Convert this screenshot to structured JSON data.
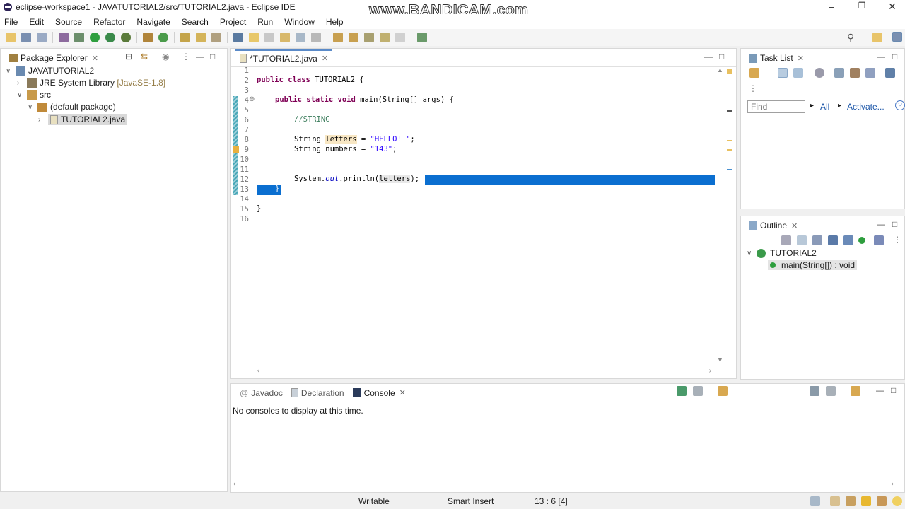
{
  "window": {
    "title": "eclipse-workspace1 - JAVATUTORIAL2/src/TUTORIAL2.java - Eclipse IDE",
    "watermark": "www.BANDICAM.com"
  },
  "menu": [
    "File",
    "Edit",
    "Source",
    "Refactor",
    "Navigate",
    "Search",
    "Project",
    "Run",
    "Window",
    "Help"
  ],
  "package_explorer": {
    "tab": "Package Explorer",
    "project": "JAVATUTORIAL2",
    "jre": "JRE System Library",
    "jre_version": "[JavaSE-1.8]",
    "src": "src",
    "package": "(default package)",
    "file": "TUTORIAL2.java"
  },
  "editor": {
    "tab": "*TUTORIAL2.java",
    "line_numbers": [
      "1",
      "2",
      "3",
      "4",
      "5",
      "6",
      "7",
      "8",
      "9",
      "10",
      "11",
      "12",
      "13",
      "14",
      "15",
      "16"
    ],
    "code": {
      "l2_kw1": "public",
      "l2_kw2": "class",
      "l2_name": "TUTORIAL2 {",
      "l4_kw1": "public",
      "l4_kw2": "static",
      "l4_kw3": "void",
      "l4_rest": "main(String[] args) {",
      "l6": "//STRING",
      "l8_type": "String",
      "l8_var": "letters",
      "l8_eq": " = ",
      "l8_str": "\"HELLO! \"",
      "l8_end": ";",
      "l9_type": "String",
      "l9_var": "numbers",
      "l9_eq": " = ",
      "l9_str": "\"143\"",
      "l9_end": ";",
      "l12_a": "System.",
      "l12_field": "out",
      "l12_b": ".println(",
      "l12_var": "letters",
      "l12_c": ");",
      "l13": "}",
      "l15": "}"
    }
  },
  "task_list": {
    "tab": "Task List",
    "find_placeholder": "Find",
    "all": "All",
    "activate": "Activate..."
  },
  "outline": {
    "tab": "Outline",
    "class_name": "TUTORIAL2",
    "method": "main(String[]) : void"
  },
  "bottom": {
    "tabs": [
      "Javadoc",
      "Declaration",
      "Console"
    ],
    "console_message": "No consoles to display at this time."
  },
  "status": {
    "writable": "Writable",
    "insert_mode": "Smart Insert",
    "position": "13 : 6 [4]"
  }
}
